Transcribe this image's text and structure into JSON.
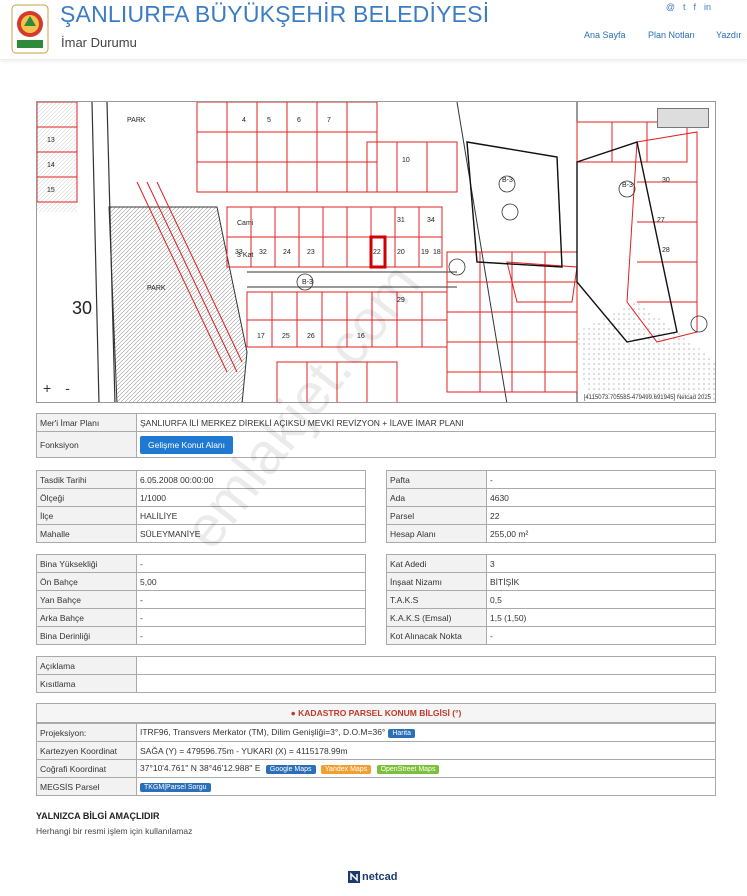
{
  "header": {
    "title": "ŞANLIURFA BÜYÜKŞEHİR BELEDİYESİ",
    "subtitle": "İmar Durumu",
    "nav": [
      "Ana Sayfa",
      "Plan Notları",
      "Yazdır"
    ],
    "social_icons": [
      "email-icon",
      "twitter-icon",
      "facebook-icon",
      "linkedin-icon"
    ]
  },
  "map": {
    "zoom_in": "+",
    "zoom_out": "-",
    "attribution": "[4115073.705585-479499.691945] Netcad 2025",
    "block_numbers": [
      "33",
      "32",
      "24",
      "23",
      "22",
      "20",
      "19",
      "18",
      "31",
      "34",
      "29",
      "30",
      "10",
      "13",
      "14",
      "15",
      "16",
      "17",
      "25",
      "26",
      "27",
      "28"
    ],
    "labels": [
      "PARK",
      "PARK",
      "B-3",
      "B-3",
      "B-3",
      "30",
      "3 Kat",
      "Cami"
    ]
  },
  "plan_row": {
    "label": "Mer'i İmar Planı",
    "value": "ŞANLIURFA İLİ MERKEZ DİREKLİ AÇIKSU MEVKİ REVİZYON + İLAVE İMAR PLANI"
  },
  "function_row": {
    "label": "Fonksiyon",
    "value": "Gelişme Konut Alanı"
  },
  "left_info": [
    {
      "label": "Tasdik Tarihi",
      "value": "6.05.2008 00:00:00"
    },
    {
      "label": "Ölçeği",
      "value": "1/1000"
    },
    {
      "label": "İlçe",
      "value": "HALİLİYE"
    },
    {
      "label": "Mahalle",
      "value": "SÜLEYMANİYE"
    }
  ],
  "right_info": [
    {
      "label": "Pafta",
      "value": "-"
    },
    {
      "label": "Ada",
      "value": "4630"
    },
    {
      "label": "Parsel",
      "value": "22"
    },
    {
      "label": "Hesap Alanı",
      "value": "255,00 m²"
    }
  ],
  "left_build": [
    {
      "label": "Bina Yüksekliği",
      "value": "-"
    },
    {
      "label": "Ön Bahçe",
      "value": "5,00"
    },
    {
      "label": "Yan Bahçe",
      "value": "-"
    },
    {
      "label": "Arka Bahçe",
      "value": "-"
    },
    {
      "label": "Bina Derinliği",
      "value": "-"
    }
  ],
  "right_build": [
    {
      "label": "Kat Adedi",
      "value": "3"
    },
    {
      "label": "İnşaat Nizamı",
      "value": "BİTİŞİK"
    },
    {
      "label": "T.A.K.S",
      "value": "0,5"
    },
    {
      "label": "K.A.K.S (Emsal)",
      "value": "1,5 (1,50)"
    },
    {
      "label": "Kot Alınacak Nokta",
      "value": "-"
    }
  ],
  "notes": [
    {
      "label": "Açıklama",
      "value": ""
    },
    {
      "label": "Kısıtlama",
      "value": ""
    }
  ],
  "kadastro": {
    "title": "KADASTRO PARSEL KONUM BİLGİSİ (°)",
    "rows": [
      {
        "label": "Projeksiyon:",
        "value": "ITRF96, Transvers Merkator (TM), Dilim Genişliği=3°, D.O.M=36°",
        "buttons": [
          "Harita"
        ]
      },
      {
        "label": "Kartezyen Koordinat",
        "value": "SAĞA (Y) = 479596.75m - YUKARI (X) = 4115178.99m",
        "buttons": []
      },
      {
        "label": "Coğrafi Koordinat",
        "value": "37°10'4.761'' N 38°46'12.988'' E",
        "buttons": [
          "Google Maps",
          "Yandex Maps",
          "OpenStreet Maps"
        ]
      },
      {
        "label": "MEGSİS Parsel",
        "value": "",
        "buttons": [
          "TKGM|Parsel Sorgu"
        ]
      }
    ]
  },
  "disclaimer": {
    "heading": "YALNIZCA BİLGİ AMAÇLIDIR",
    "text": "Herhangi bir resmi işlem için kullanılamaz"
  },
  "footer": {
    "brand": "netcad"
  },
  "watermark": "emlakjet.com",
  "colors": {
    "brand_blue": "#3b7cc4",
    "button_blue": "#1f78d1",
    "map_red": "#e02020",
    "harita_tag": "#2a6fb8",
    "google_tag": "#2a6fb8",
    "yandex_tag": "#f0a030",
    "osm_tag": "#7cbf3a",
    "tkgm_tag": "#2a6fb8"
  }
}
